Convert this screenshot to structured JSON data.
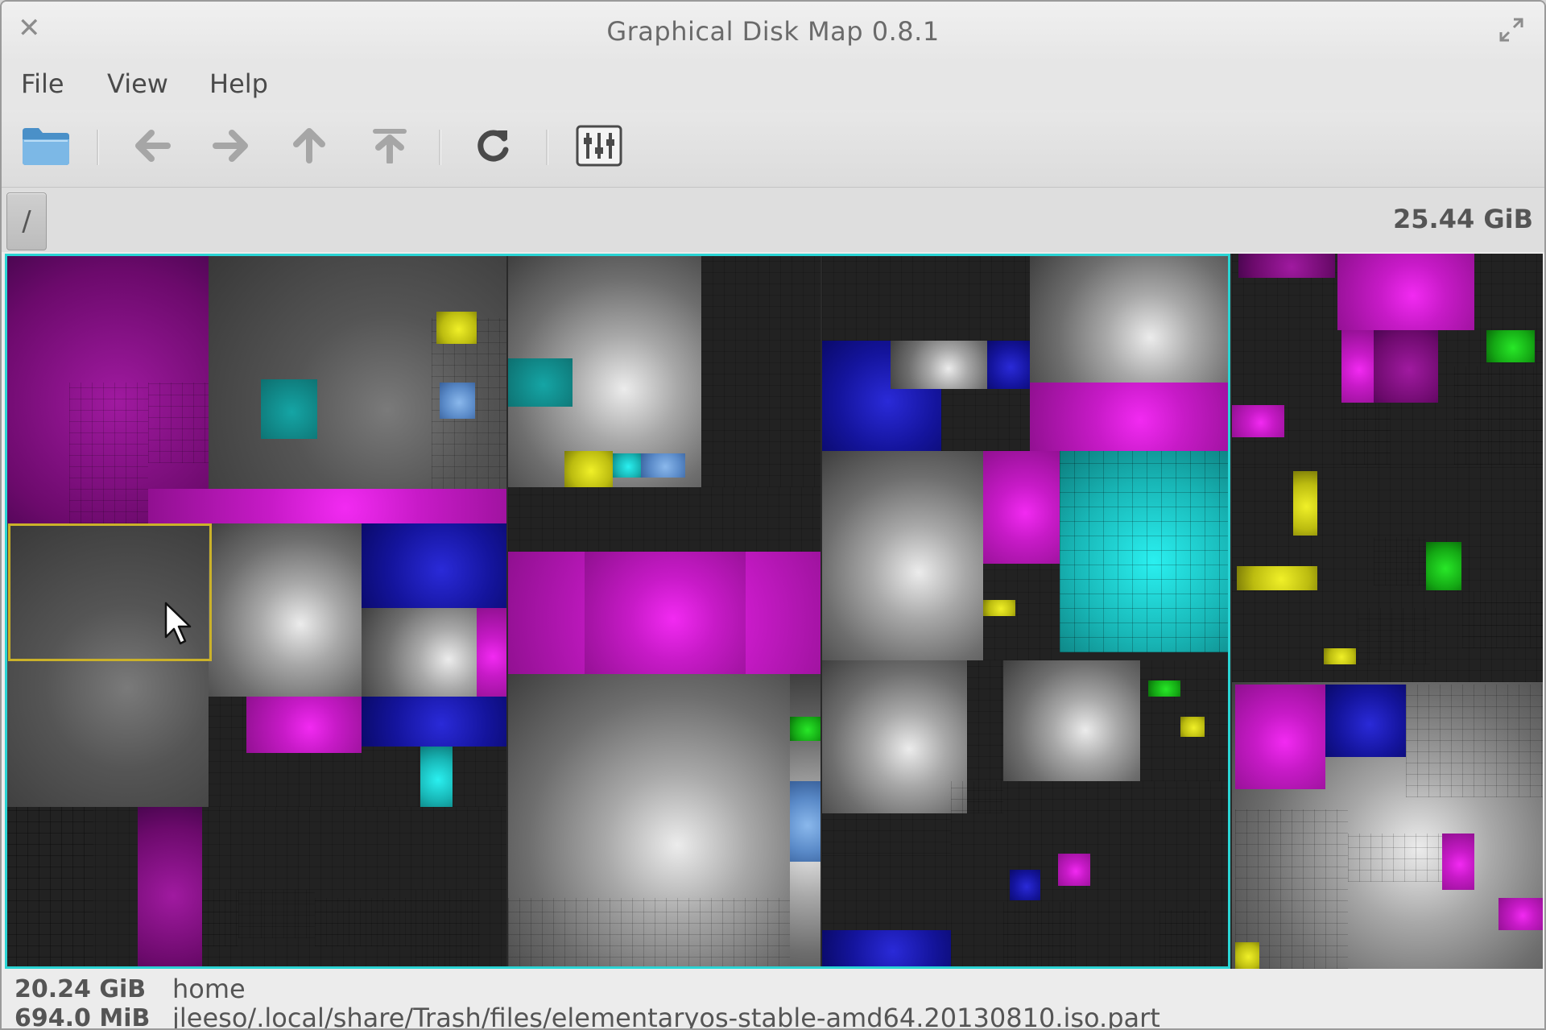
{
  "window": {
    "title": "Graphical Disk Map 0.8.1",
    "close_icon": "close-icon",
    "maximize_icon": "maximize-icon"
  },
  "menu": {
    "file": "File",
    "view": "View",
    "help": "Help"
  },
  "toolbar": {
    "icons": [
      "folder-open-icon",
      "back-arrow-icon",
      "forward-arrow-icon",
      "up-arrow-icon",
      "top-arrow-icon",
      "refresh-icon",
      "settings-sliders-icon"
    ],
    "disabled": [
      "back",
      "forward",
      "up",
      "top"
    ]
  },
  "pathbar": {
    "root_label": "/",
    "total_size": "25.44 GiB"
  },
  "status": {
    "selected_size": "20.24 GiB",
    "selected_name": "home",
    "hover_size": "694.0 MiB",
    "hover_path": "jleeso/.local/share/Trash/files/elementaryos-stable-amd64.20130810.iso.part"
  },
  "colors": {
    "selection_border": "#2ad4d4",
    "hover_border": "#cbb22a",
    "magenta": "#c71ac7",
    "blue": "#14149c",
    "cyan": "#18b6b6",
    "yellow": "#bcbc10",
    "green": "#14a814",
    "light_blue": "#5a8ac8"
  }
}
